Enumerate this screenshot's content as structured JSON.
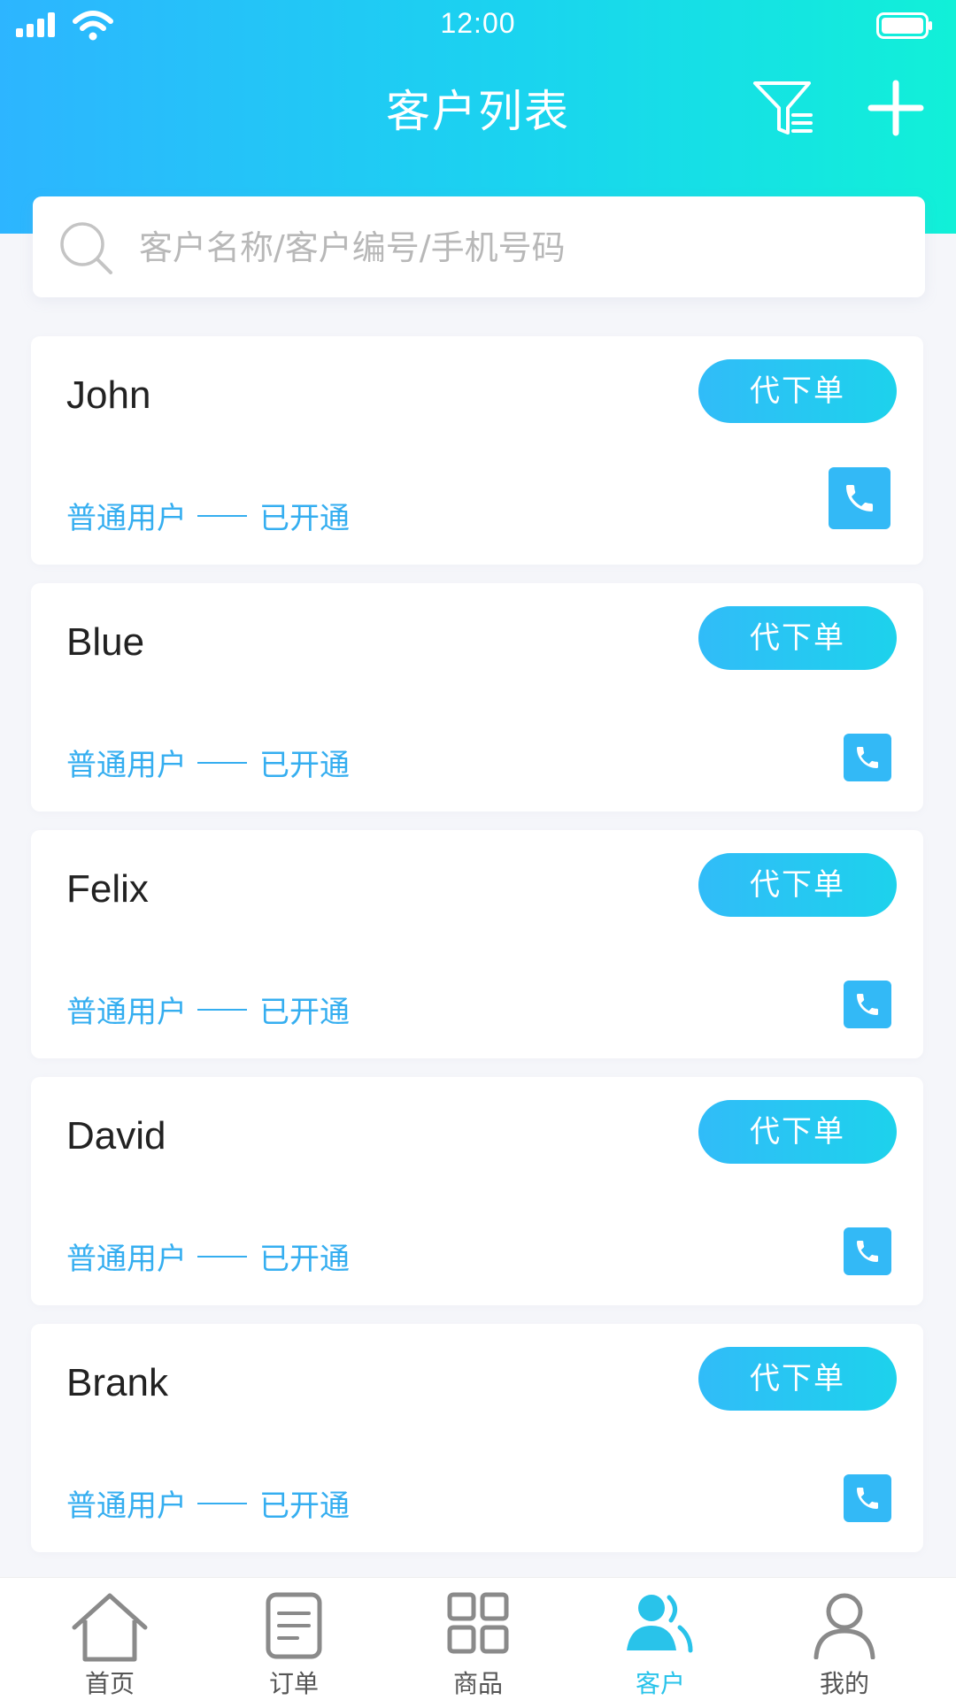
{
  "status_bar": {
    "time": "12:00"
  },
  "header": {
    "title": "客户列表",
    "icons": [
      "filter-icon",
      "plus-icon"
    ]
  },
  "search": {
    "placeholder": "客户名称/客户编号/手机号码"
  },
  "customers": [
    {
      "name": "John",
      "order_label": "代下单",
      "type": "普通用户",
      "status": "已开通"
    },
    {
      "name": "Blue",
      "order_label": "代下单",
      "type": "普通用户",
      "status": "已开通"
    },
    {
      "name": "Felix",
      "order_label": "代下单",
      "type": "普通用户",
      "status": "已开通"
    },
    {
      "name": "David",
      "order_label": "代下单",
      "type": "普通用户",
      "status": "已开通"
    },
    {
      "name": "Brank",
      "order_label": "代下单",
      "type": "普通用户",
      "status": "已开通"
    }
  ],
  "tabs": [
    {
      "label": "首页",
      "icon": "home-icon"
    },
    {
      "label": "订单",
      "icon": "order-icon"
    },
    {
      "label": "商品",
      "icon": "grid-icon"
    },
    {
      "label": "客户",
      "icon": "customers-icon",
      "active": true
    },
    {
      "label": "我的",
      "icon": "user-icon"
    }
  ],
  "colors": {
    "header_gradient_start": "#2db5ff",
    "header_gradient_end": "#11f0d8",
    "accent_blue": "#35aef0",
    "active_tab": "#29c3ea",
    "page_bg": "#f5f6fa"
  }
}
